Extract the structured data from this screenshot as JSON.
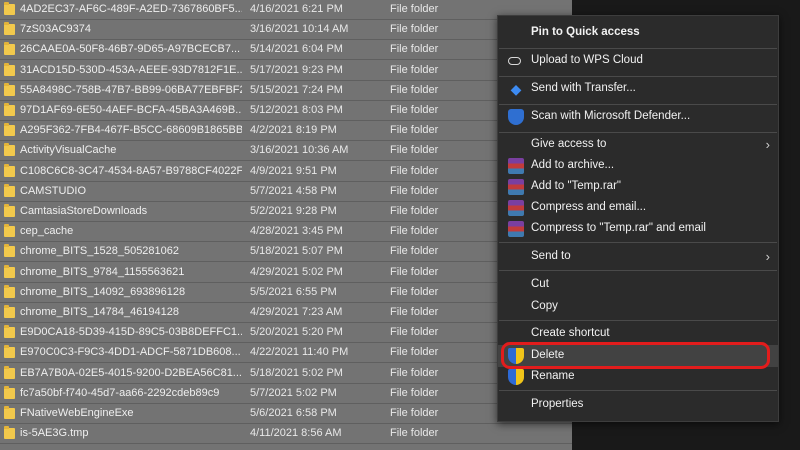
{
  "files": [
    {
      "name": "4AD2EC37-AF6C-489F-A2ED-7367860BF5...",
      "date": "4/16/2021 6:21 PM",
      "type": "File folder"
    },
    {
      "name": "7zS03AC9374",
      "date": "3/16/2021 10:14 AM",
      "type": "File folder"
    },
    {
      "name": "26CAAE0A-50F8-46B7-9D65-A97BCECB7...",
      "date": "5/14/2021 6:04 PM",
      "type": "File folder"
    },
    {
      "name": "31ACD15D-530D-453A-AEEE-93D7812F1E...",
      "date": "5/17/2021 9:23 PM",
      "type": "File folder"
    },
    {
      "name": "55A8498C-758B-47B7-BB99-06BA77EBFBF2",
      "date": "5/15/2021 7:24 PM",
      "type": "File folder"
    },
    {
      "name": "97D1AF69-6E50-4AEF-BCFA-45BA3A469B...",
      "date": "5/12/2021 8:03 PM",
      "type": "File folder"
    },
    {
      "name": "A295F362-7FB4-467F-B5CC-68609B1865BB",
      "date": "4/2/2021 8:19 PM",
      "type": "File folder"
    },
    {
      "name": "ActivityVisualCache",
      "date": "3/16/2021 10:36 AM",
      "type": "File folder"
    },
    {
      "name": "C108C6C8-3C47-4534-8A57-B9788CF4022F",
      "date": "4/9/2021 9:51 PM",
      "type": "File folder"
    },
    {
      "name": "CAMSTUDIO",
      "date": "5/7/2021 4:58 PM",
      "type": "File folder"
    },
    {
      "name": "CamtasiaStoreDownloads",
      "date": "5/2/2021 9:28 PM",
      "type": "File folder"
    },
    {
      "name": "cep_cache",
      "date": "4/28/2021 3:45 PM",
      "type": "File folder"
    },
    {
      "name": "chrome_BITS_1528_505281062",
      "date": "5/18/2021 5:07 PM",
      "type": "File folder"
    },
    {
      "name": "chrome_BITS_9784_1155563621",
      "date": "4/29/2021 5:02 PM",
      "type": "File folder"
    },
    {
      "name": "chrome_BITS_14092_693896128",
      "date": "5/5/2021 6:55 PM",
      "type": "File folder"
    },
    {
      "name": "chrome_BITS_14784_46194128",
      "date": "4/29/2021 7:23 AM",
      "type": "File folder"
    },
    {
      "name": "E9D0CA18-5D39-415D-89C5-03B8DEFFC1...",
      "date": "5/20/2021 5:20 PM",
      "type": "File folder"
    },
    {
      "name": "E970C0C3-F9C3-4DD1-ADCF-5871DB608...",
      "date": "4/22/2021 11:40 PM",
      "type": "File folder"
    },
    {
      "name": "EB7A7B0A-02E5-4015-9200-D2BEA56C81...",
      "date": "5/18/2021 5:02 PM",
      "type": "File folder"
    },
    {
      "name": "fc7a50bf-f740-45d7-aa66-2292cdeb89c9",
      "date": "5/7/2021 5:02 PM",
      "type": "File folder"
    },
    {
      "name": "FNativeWebEngineExe",
      "date": "5/6/2021 6:58 PM",
      "type": "File folder"
    },
    {
      "name": "is-5AE3G.tmp",
      "date": "4/11/2021 8:56 AM",
      "type": "File folder"
    }
  ],
  "menu": {
    "pin": "Pin to Quick access",
    "wps": "Upload to WPS Cloud",
    "transfer": "Send with Transfer...",
    "defender": "Scan with Microsoft Defender...",
    "give_access": "Give access to",
    "add_archive": "Add to archive...",
    "add_temp": "Add to \"Temp.rar\"",
    "compress_email": "Compress and email...",
    "compress_temp_email": "Compress to \"Temp.rar\" and email",
    "send_to": "Send to",
    "cut": "Cut",
    "copy": "Copy",
    "create_shortcut": "Create shortcut",
    "delete": "Delete",
    "rename": "Rename",
    "properties": "Properties",
    "submenu_arrow": "›"
  },
  "icons": {
    "folder": "folder-icon",
    "cloud": "cloud-icon",
    "dropbox": "dropbox-icon",
    "defender": "shield-icon",
    "winrar": "winrar-icon",
    "uac": "uac-shield-icon"
  },
  "colors": {
    "highlight_border": "#e21c1c",
    "menu_bg": "#2b2b2b",
    "list_bg": "#737373",
    "folder": "#f2c94c"
  }
}
